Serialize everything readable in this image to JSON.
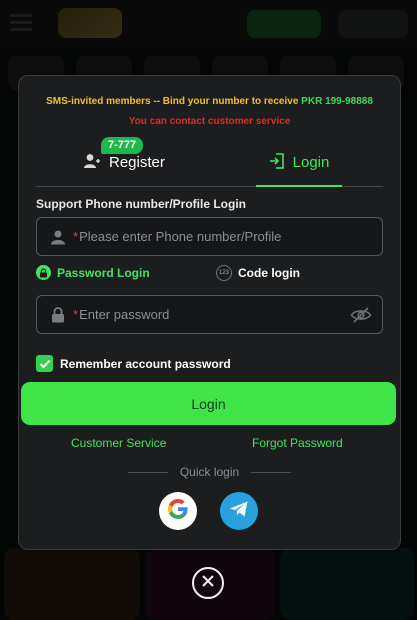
{
  "notice": {
    "text": "SMS-invited members -- Bind your number to receive",
    "amount": "PKR 199-98888",
    "contact": "You can contact customer service"
  },
  "tabs": {
    "register_label": "Register",
    "register_badge": "7-777",
    "login_label": "Login",
    "active": "login"
  },
  "phone": {
    "label": "Support Phone number/Profile Login",
    "placeholder": "Please enter Phone number/Profile",
    "required_mark": "*",
    "value": ""
  },
  "login_modes": {
    "password_label": "Password Login",
    "code_label": "Code login",
    "code_icon_text": "123",
    "selected": "password"
  },
  "password": {
    "placeholder": "Enter password",
    "required_mark": "*",
    "value": ""
  },
  "remember": {
    "label": "Remember account password",
    "checked": true
  },
  "login_button": "Login",
  "links": {
    "customer_service": "Customer Service",
    "forgot_password": "Forgot Password"
  },
  "quick_login": {
    "label": "Quick login",
    "providers": [
      "google-icon",
      "telegram-icon"
    ]
  },
  "colors": {
    "accent": "#3fe65a",
    "button": "#3fe548",
    "warning": "#f0c02a",
    "error": "#e02b2b",
    "modal_bg": "#1c1d1f"
  }
}
